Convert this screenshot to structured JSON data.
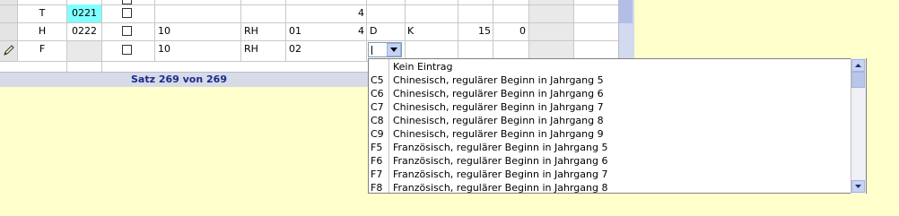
{
  "grid": {
    "rows": [
      {
        "marker": "",
        "typ": "T",
        "kuerzel": "0221",
        "checked": false,
        "klasse": "",
        "gruppe": "",
        "nr": "",
        "stunden": "4",
        "fach": "",
        "lehrer": "",
        "wert1": "",
        "wert2": ""
      },
      {
        "marker": "",
        "typ": "H",
        "kuerzel": "0222",
        "checked": false,
        "klasse": "10",
        "gruppe": "RH",
        "nr": "01",
        "stunden": "4",
        "fach": "D",
        "lehrer": "K",
        "wert1": "15",
        "wert2": "0"
      },
      {
        "marker": "pencil-icon",
        "typ": "F",
        "kuerzel": "",
        "checked": false,
        "klasse": "10",
        "gruppe": "RH",
        "nr": "02",
        "stunden": "",
        "fach": "",
        "lehrer": "",
        "wert1": "",
        "wert2": ""
      }
    ]
  },
  "footer": {
    "record_text": "Satz 269 von 269"
  },
  "dropdown": {
    "items": [
      {
        "code": "",
        "text": "Kein Eintrag"
      },
      {
        "code": "C5",
        "text": "Chinesisch, regulärer Beginn in Jahrgang 5"
      },
      {
        "code": "C6",
        "text": "Chinesisch, regulärer Beginn in Jahrgang 6"
      },
      {
        "code": "C7",
        "text": "Chinesisch, regulärer Beginn in Jahrgang 7"
      },
      {
        "code": "C8",
        "text": "Chinesisch, regulärer Beginn in Jahrgang 8"
      },
      {
        "code": "C9",
        "text": "Chinesisch, regulärer Beginn in Jahrgang 9"
      },
      {
        "code": "F5",
        "text": "Französisch, regulärer Beginn in Jahrgang 5"
      },
      {
        "code": "F6",
        "text": "Französisch, regulärer Beginn in Jahrgang 6"
      },
      {
        "code": "F7",
        "text": "Französisch, regulärer Beginn in Jahrgang 7"
      },
      {
        "code": "F8",
        "text": "Französisch, regulärer Beginn in Jahrgang 8"
      }
    ]
  },
  "icons": {
    "row_marker": "pencil-icon",
    "dropdown_toggle": "chevron-down-icon",
    "scroll_up": "arrow-up-icon",
    "scroll_down": "arrow-down-icon"
  },
  "colors": {
    "background": "#ffffcc",
    "kuerzel_highlight": "#80ffff",
    "footer_text": "#1a2c8c"
  }
}
